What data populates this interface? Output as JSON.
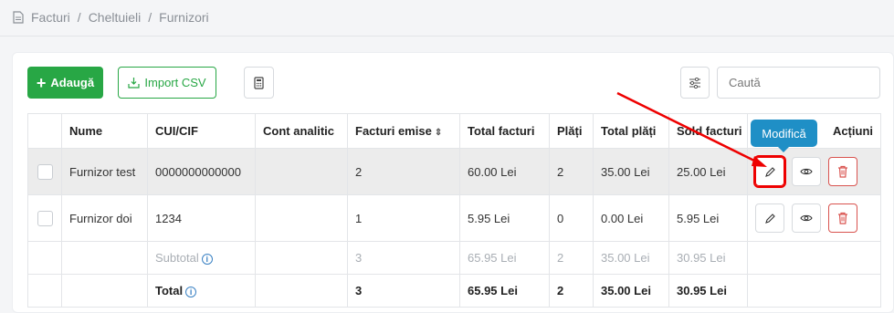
{
  "breadcrumb": {
    "items": [
      "Facturi",
      "Cheltuieli",
      "Furnizori"
    ],
    "separator": "/"
  },
  "toolbar": {
    "add_label": "Adaugă",
    "import_label": "Import CSV",
    "search_placeholder": "Caută"
  },
  "table": {
    "headers": [
      "",
      "Nume",
      "CUI/CIF",
      "Cont analitic",
      "Facturi emise",
      "Total facturi",
      "Plăți",
      "Total plăți",
      "Sold facturi",
      "Acțiuni"
    ],
    "rows": [
      {
        "nume": "Furnizor test",
        "cui": "0000000000000",
        "cont": "",
        "facturi": "2",
        "total_facturi": "60.00 Lei",
        "plati": "2",
        "total_plati": "35.00 Lei",
        "sold": "25.00 Lei"
      },
      {
        "nume": "Furnizor doi",
        "cui": "1234",
        "cont": "",
        "facturi": "1",
        "total_facturi": "5.95 Lei",
        "plati": "0",
        "total_plati": "0.00 Lei",
        "sold": "5.95 Lei"
      }
    ],
    "subtotal": {
      "label": "Subtotal",
      "facturi": "3",
      "total_facturi": "65.95 Lei",
      "plati": "2",
      "total_plati": "35.00 Lei",
      "sold": "30.95 Lei"
    },
    "total": {
      "label": "Total",
      "facturi": "3",
      "total_facturi": "65.95 Lei",
      "plati": "2",
      "total_plati": "35.00 Lei",
      "sold": "30.95 Lei"
    }
  },
  "tooltip": {
    "text": "Modifică"
  },
  "colors": {
    "accent_green": "#28a745",
    "danger": "#d9534f",
    "tooltip": "#1f8fc6",
    "highlight": "#e00000"
  }
}
